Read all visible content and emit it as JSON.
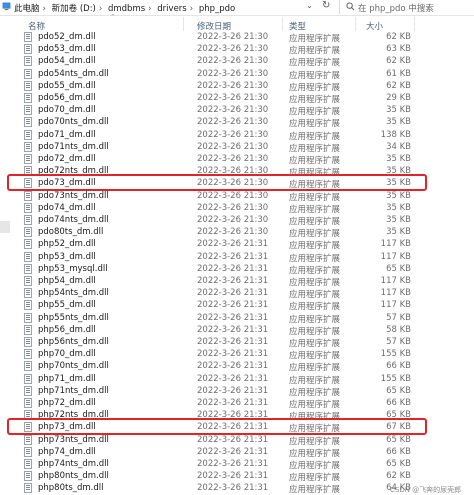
{
  "address_bar": {
    "crumbs": [
      "此电脑",
      "新加卷 (D:)",
      "dmdbms",
      "drivers",
      "php_pdo"
    ],
    "separator": "›",
    "search_placeholder": "在 php_pdo 中搜索"
  },
  "columns": {
    "name": "名称",
    "date": "修改日期",
    "type": "类型",
    "size": "大小"
  },
  "files": [
    {
      "name": "pdo52_dm.dll",
      "date": "2022-3-26 21:30",
      "type": "应用程序扩展",
      "size": "62 KB"
    },
    {
      "name": "pdo53_dm.dll",
      "date": "2022-3-26 21:30",
      "type": "应用程序扩展",
      "size": "63 KB"
    },
    {
      "name": "pdo54_dm.dll",
      "date": "2022-3-26 21:30",
      "type": "应用程序扩展",
      "size": "62 KB"
    },
    {
      "name": "pdo54nts_dm.dll",
      "date": "2022-3-26 21:30",
      "type": "应用程序扩展",
      "size": "61 KB"
    },
    {
      "name": "pdo55_dm.dll",
      "date": "2022-3-26 21:30",
      "type": "应用程序扩展",
      "size": "62 KB"
    },
    {
      "name": "pdo56_dm.dll",
      "date": "2022-3-26 21:30",
      "type": "应用程序扩展",
      "size": "29 KB"
    },
    {
      "name": "pdo70_dm.dll",
      "date": "2022-3-26 21:30",
      "type": "应用程序扩展",
      "size": "35 KB"
    },
    {
      "name": "pdo70nts_dm.dll",
      "date": "2022-3-26 21:30",
      "type": "应用程序扩展",
      "size": "35 KB"
    },
    {
      "name": "pdo71_dm.dll",
      "date": "2022-3-26 21:30",
      "type": "应用程序扩展",
      "size": "138 KB"
    },
    {
      "name": "pdo71nts_dm.dll",
      "date": "2022-3-26 21:30",
      "type": "应用程序扩展",
      "size": "34 KB"
    },
    {
      "name": "pdo72_dm.dll",
      "date": "2022-3-26 21:30",
      "type": "应用程序扩展",
      "size": "35 KB"
    },
    {
      "name": "pdo72nts_dm.dll",
      "date": "2022-3-26 21:30",
      "type": "应用程序扩展",
      "size": "35 KB"
    },
    {
      "name": "pdo73_dm.dll",
      "date": "2022-3-26 21:30",
      "type": "应用程序扩展",
      "size": "35 KB"
    },
    {
      "name": "pdo73nts_dm.dll",
      "date": "2022-3-26 21:30",
      "type": "应用程序扩展",
      "size": "35 KB"
    },
    {
      "name": "pdo74_dm.dll",
      "date": "2022-3-26 21:30",
      "type": "应用程序扩展",
      "size": "35 KB"
    },
    {
      "name": "pdo74nts_dm.dll",
      "date": "2022-3-26 21:30",
      "type": "应用程序扩展",
      "size": "35 KB"
    },
    {
      "name": "pdo80ts_dm.dll",
      "date": "2022-3-26 21:30",
      "type": "应用程序扩展",
      "size": "35 KB"
    },
    {
      "name": "php52_dm.dll",
      "date": "2022-3-26 21:31",
      "type": "应用程序扩展",
      "size": "117 KB"
    },
    {
      "name": "php53_dm.dll",
      "date": "2022-3-26 21:31",
      "type": "应用程序扩展",
      "size": "117 KB"
    },
    {
      "name": "php53_mysql.dll",
      "date": "2022-3-26 21:31",
      "type": "应用程序扩展",
      "size": "65 KB"
    },
    {
      "name": "php54_dm.dll",
      "date": "2022-3-26 21:31",
      "type": "应用程序扩展",
      "size": "117 KB"
    },
    {
      "name": "php54nts_dm.dll",
      "date": "2022-3-26 21:31",
      "type": "应用程序扩展",
      "size": "117 KB"
    },
    {
      "name": "php55_dm.dll",
      "date": "2022-3-26 21:31",
      "type": "应用程序扩展",
      "size": "117 KB"
    },
    {
      "name": "php55nts_dm.dll",
      "date": "2022-3-26 21:31",
      "type": "应用程序扩展",
      "size": "57 KB"
    },
    {
      "name": "php56_dm.dll",
      "date": "2022-3-26 21:31",
      "type": "应用程序扩展",
      "size": "58 KB"
    },
    {
      "name": "php56nts_dm.dll",
      "date": "2022-3-26 21:31",
      "type": "应用程序扩展",
      "size": "57 KB"
    },
    {
      "name": "php70_dm.dll",
      "date": "2022-3-26 21:31",
      "type": "应用程序扩展",
      "size": "155 KB"
    },
    {
      "name": "php70nts_dm.dll",
      "date": "2022-3-26 21:31",
      "type": "应用程序扩展",
      "size": "66 KB"
    },
    {
      "name": "php71_dm.dll",
      "date": "2022-3-26 21:31",
      "type": "应用程序扩展",
      "size": "155 KB"
    },
    {
      "name": "php71nts_dm.dll",
      "date": "2022-3-26 21:31",
      "type": "应用程序扩展",
      "size": "65 KB"
    },
    {
      "name": "php72_dm.dll",
      "date": "2022-3-26 21:31",
      "type": "应用程序扩展",
      "size": "66 KB"
    },
    {
      "name": "php72nts_dm.dll",
      "date": "2022-3-26 21:31",
      "type": "应用程序扩展",
      "size": "65 KB"
    },
    {
      "name": "php73_dm.dll",
      "date": "2022-3-26 21:31",
      "type": "应用程序扩展",
      "size": "67 KB"
    },
    {
      "name": "php73nts_dm.dll",
      "date": "2022-3-26 21:31",
      "type": "应用程序扩展",
      "size": "65 KB"
    },
    {
      "name": "php74_dm.dll",
      "date": "2022-3-26 21:31",
      "type": "应用程序扩展",
      "size": "66 KB"
    },
    {
      "name": "php74nts_dm.dll",
      "date": "2022-3-26 21:31",
      "type": "应用程序扩展",
      "size": "65 KB"
    },
    {
      "name": "php80nts_dm.dll",
      "date": "2022-3-26 21:31",
      "type": "应用程序扩展",
      "size": "62 KB"
    },
    {
      "name": "php80ts_dm.dll",
      "date": "2022-3-26 21:31",
      "type": "应用程序扩展",
      "size": "64 KB"
    }
  ],
  "highlighted_files": [
    "pdo73_dm.dll",
    "php73_dm.dll"
  ],
  "colors": {
    "highlight_border": "#e0242a",
    "header_text": "#4c607a",
    "detail_text": "#6d6d6d"
  },
  "watermark": "CSDN @飞奔的尿壳郎"
}
